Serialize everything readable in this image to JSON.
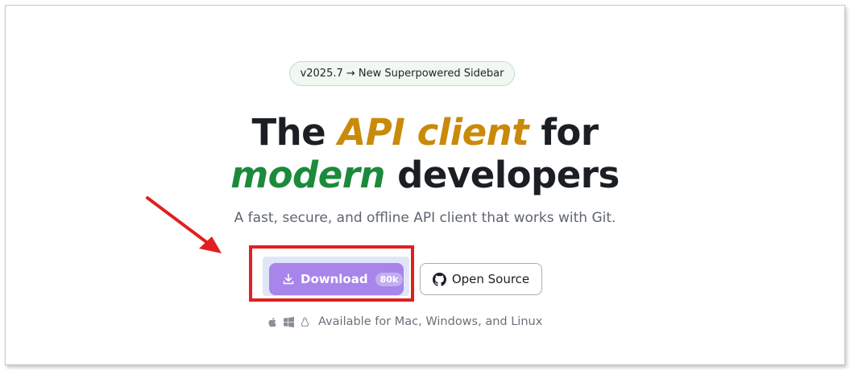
{
  "announcement": {
    "label": "v2025.7 → New Superpowered Sidebar"
  },
  "hero": {
    "line1_pre": "The ",
    "line1_highlight": "API client",
    "line1_post": " for",
    "line2_highlight": "modern",
    "line2_post": " developers",
    "subtitle": "A fast, secure, and offline API client that works with Git."
  },
  "actions": {
    "download_label": "Download",
    "download_count": "80k",
    "open_source_label": "Open Source"
  },
  "platforms": {
    "text": "Available for Mac, Windows, and Linux",
    "icons": [
      "apple-icon",
      "windows-icon",
      "linux-icon"
    ]
  },
  "colors": {
    "accent_gold": "#c98a0a",
    "accent_green": "#1c8a3b",
    "download_purple": "#a785ea",
    "annotation_red": "#e02020"
  }
}
